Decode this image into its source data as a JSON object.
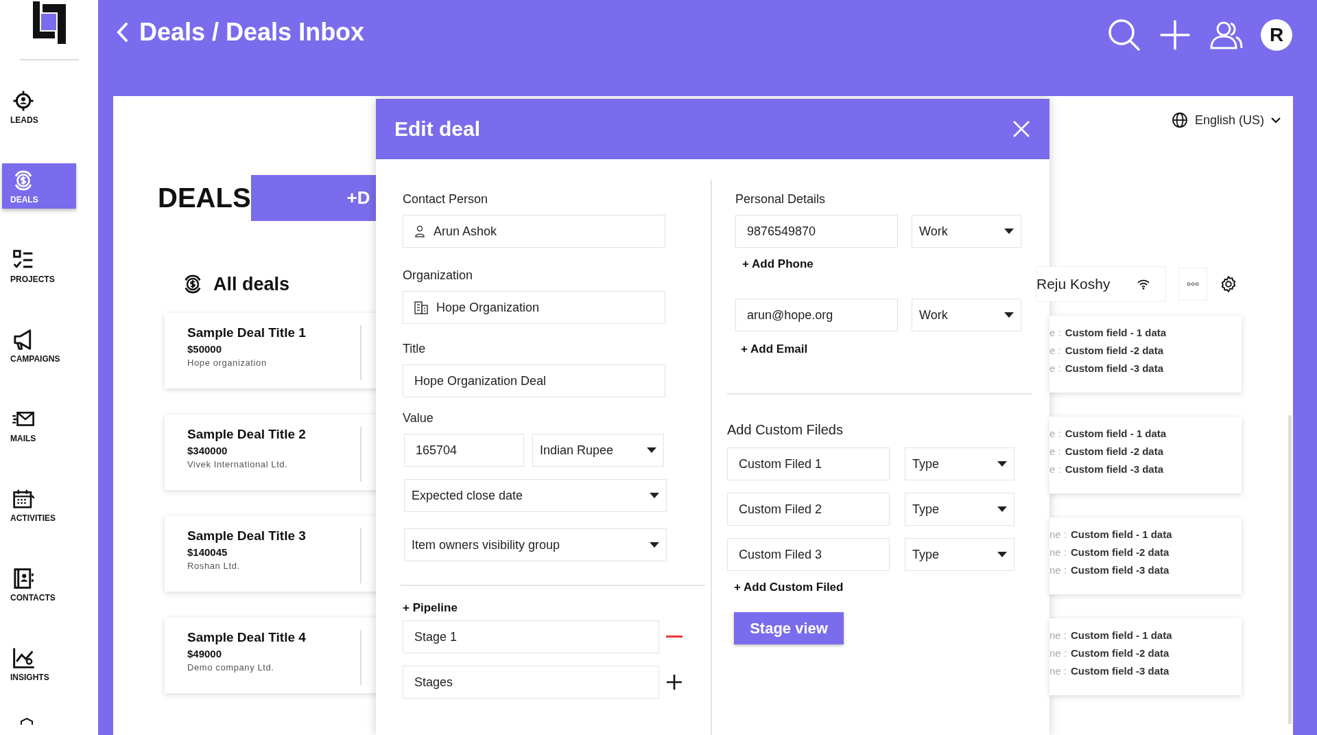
{
  "header": {
    "title": "Deals / Deals Inbox",
    "avatar": "R"
  },
  "sidebar": {
    "items": [
      {
        "label": "LEADS",
        "selected": false
      },
      {
        "label": "DEALS",
        "selected": true
      },
      {
        "label": "PROJECTS",
        "selected": false
      },
      {
        "label": "CAMPAIGNS",
        "selected": false
      },
      {
        "label": "MAILS",
        "selected": false
      },
      {
        "label": "ACTIVITIES",
        "selected": false
      },
      {
        "label": "CONTACTS",
        "selected": false
      },
      {
        "label": "INSIGHTS",
        "selected": false
      }
    ]
  },
  "page": {
    "heading": "DEALS",
    "add_button": "+D",
    "list_title": "All deals",
    "language": "English (US)",
    "owner": "Reju Koshy"
  },
  "deals": [
    {
      "title": "Sample Deal Title 1",
      "amount": "$50000",
      "organization": "Hope organization"
    },
    {
      "title": "Sample Deal Title 2",
      "amount": "$340000",
      "organization": "Vivek International Ltd."
    },
    {
      "title": "Sample Deal Title 3",
      "amount": "$140045",
      "organization": "Roshan Ltd."
    },
    {
      "title": "Sample Deal Title 4",
      "amount": "$49000",
      "organization": "Demo company Ltd."
    }
  ],
  "detail_cards": [
    {
      "rows": [
        {
          "label": "e :",
          "value": "Custom field - 1 data"
        },
        {
          "label": "e :",
          "value": "Custom field -2 data"
        },
        {
          "label": "e :",
          "value": "Custom field -3 data"
        }
      ]
    },
    {
      "rows": [
        {
          "label": "e :",
          "value": "Custom field - 1 data"
        },
        {
          "label": "e :",
          "value": "Custom field -2 data"
        },
        {
          "label": "e :",
          "value": "Custom field -3 data"
        }
      ]
    },
    {
      "rows": [
        {
          "label": "ne :",
          "value": "Custom field - 1 data"
        },
        {
          "label": "ne :",
          "value": "Custom field -2 data"
        },
        {
          "label": "ne :",
          "value": "Custom field -3 data"
        }
      ]
    },
    {
      "rows": [
        {
          "label": "ne :",
          "value": "Custom field - 1 data"
        },
        {
          "label": "ne :",
          "value": "Custom field -2 data"
        },
        {
          "label": "ne :",
          "value": "Custom field -3 data"
        }
      ]
    }
  ],
  "modal": {
    "title": "Edit deal",
    "contact_label": "Contact Person",
    "contact": "Arun Ashok",
    "organization_label": "Organization",
    "organization": "Hope Organization",
    "title_label": "Title",
    "deal_title": "Hope Organization Deal",
    "value_label": "Value",
    "amount": "165704",
    "currency": "Indian Rupee",
    "close_date": "Expected close date",
    "visibility": "Item owners visibility group",
    "pipeline": "+ Pipeline",
    "stages": [
      {
        "value": "Stage 1",
        "kind": "remove"
      },
      {
        "value": "Stages",
        "kind": "add"
      }
    ],
    "personal_label": "Personal Details",
    "phones": [
      {
        "value": "9876549870",
        "type": "Work"
      }
    ],
    "add_phone": "+ Add Phone",
    "emails": [
      {
        "value": "arun@hope.org",
        "type": "Work"
      }
    ],
    "add_email": "+ Add Email",
    "custom_title": "Add Custom Fileds",
    "custom_fields": [
      {
        "name": "Custom Filed 1",
        "type": "Type"
      },
      {
        "name": "Custom Filed 2",
        "type": "Type"
      },
      {
        "name": "Custom Filed 3",
        "type": "Type"
      }
    ],
    "add_custom": "+ Add Custom Filed",
    "stage_view": "Stage view"
  }
}
